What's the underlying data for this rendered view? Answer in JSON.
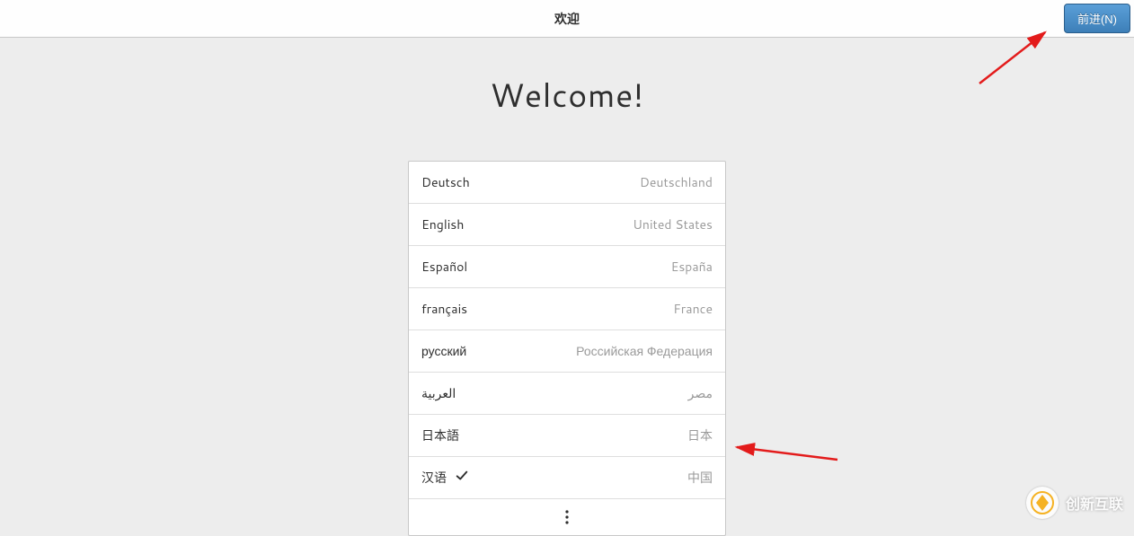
{
  "header": {
    "title": "欢迎",
    "next_label": "前进(N)"
  },
  "main": {
    "heading": "Welcome!",
    "languages": [
      {
        "name": "Deutsch",
        "region": "Deutschland",
        "selected": false
      },
      {
        "name": "English",
        "region": "United States",
        "selected": false
      },
      {
        "name": "Español",
        "region": "España",
        "selected": false
      },
      {
        "name": "français",
        "region": "France",
        "selected": false
      },
      {
        "name": "русский",
        "region": "Российская Федерация",
        "selected": false
      },
      {
        "name": "العربية",
        "region": "مصر",
        "selected": false
      },
      {
        "name": "日本語",
        "region": "日本",
        "selected": false
      },
      {
        "name": "汉语",
        "region": "中国",
        "selected": true
      }
    ]
  },
  "watermark": {
    "text": "创新互联"
  }
}
